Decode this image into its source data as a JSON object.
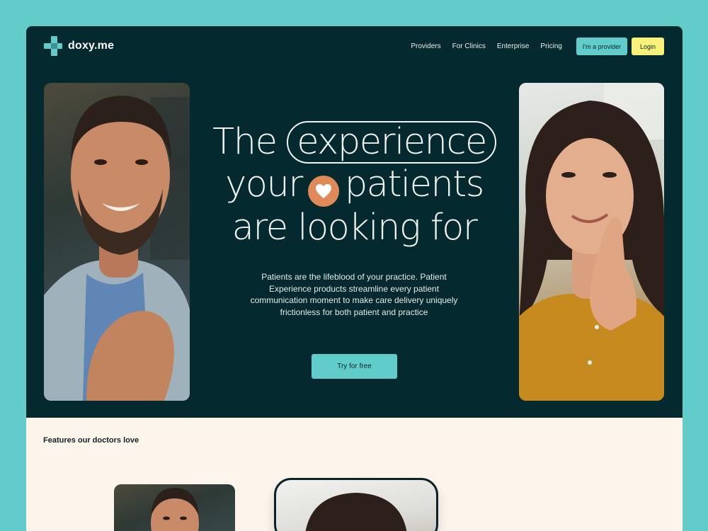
{
  "brand": {
    "name": "doxy.me",
    "logo_icon": "plus-cross-logo",
    "accent": "#62cccb",
    "dark": "#04292e",
    "yellow": "#f8f27a",
    "heart_color": "#e08a5a"
  },
  "nav": {
    "links": [
      "Providers",
      "For Clinics",
      "Enterprise",
      "Pricing"
    ],
    "provider_button": "I'm a provider",
    "login_button": "Login"
  },
  "hero": {
    "headline_part1": "The",
    "headline_highlight": "experience",
    "headline_part2a": "your",
    "headline_icon": "heart-icon",
    "headline_part2b": "patients",
    "headline_part3": "are looking for",
    "subtext": "Patients are the lifeblood of your practice. Patient Experience products streamline every patient communication moment to make care delivery uniquely frictionless for both patient and practice",
    "cta": "Try for free"
  },
  "features": {
    "title": "Features our doctors love"
  }
}
